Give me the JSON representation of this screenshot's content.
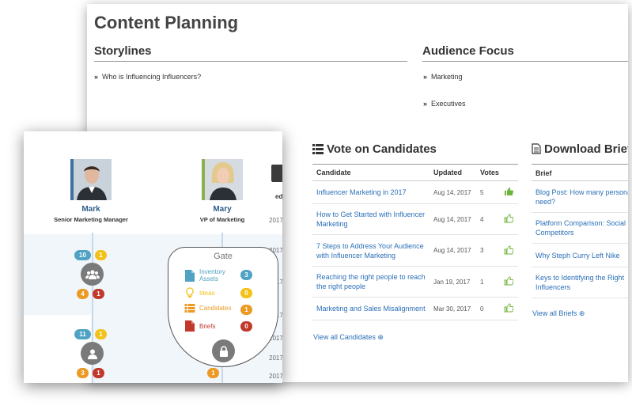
{
  "page": {
    "title": "Content Planning"
  },
  "storylines": {
    "heading": "Storylines",
    "items": [
      "Who is Influencing Influencers?"
    ]
  },
  "audience": {
    "heading": "Audience Focus",
    "items": [
      "Marketing",
      "Executives"
    ]
  },
  "bullet_glyph": "»",
  "vote": {
    "heading": "Vote on Candidates",
    "columns": {
      "candidate": "Candidate",
      "updated": "Updated",
      "votes": "Votes"
    },
    "rows": [
      {
        "candidate": "Influencer Marketing in 2017",
        "updated": "Aug 14, 2017",
        "votes": "5",
        "thumb": "filled"
      },
      {
        "candidate": "How to Get Started with Influencer Marketing",
        "updated": "Aug 14, 2017",
        "votes": "4",
        "thumb": "outline"
      },
      {
        "candidate": "7 Steps to Address Your Audience with Influencer Marketing",
        "updated": "Aug 14, 2017",
        "votes": "3",
        "thumb": "outline"
      },
      {
        "candidate": "Reaching the right people to reach the right people",
        "updated": "Jan 19, 2017",
        "votes": "1",
        "thumb": "outline"
      },
      {
        "candidate": "Marketing and Sales Misalignment",
        "updated": "Mar 30, 2017",
        "votes": "0",
        "thumb": "outline"
      }
    ],
    "view_all": "View all Candidates ⊕"
  },
  "briefs": {
    "heading": "Download Brief",
    "column": "Brief",
    "rows": [
      "Blog Post: How many personal need?",
      "Platform Comparison: Social Competitors",
      "Why Steph Curry Left Nike",
      "Keys to Identifying the Right Influencers"
    ],
    "view_all": "View all Briefs ⊕"
  },
  "team": {
    "people": [
      {
        "name": "Mark",
        "role": "Senior Marketing Manager"
      },
      {
        "name": "Mary",
        "role": "VP of Marketing"
      }
    ],
    "submit_label": "mit",
    "ghost_header": "ed",
    "ghost_years": [
      "2017",
      "2017",
      "2017",
      "2017",
      "2017",
      "2017",
      "2017"
    ]
  },
  "workflow": {
    "group_top": {
      "blue": "10",
      "yellow": "1",
      "orange": "4",
      "red": "1"
    },
    "group_bottom": {
      "blue": "11",
      "yellow": "1",
      "orange": "3",
      "red": "1"
    },
    "gate_bottom_badge": "1"
  },
  "gate": {
    "title": "Gate",
    "items": [
      {
        "label": "Inventory Assets",
        "count": "3",
        "color": "#4fa2c4",
        "icon": "document-icon"
      },
      {
        "label": "Ideas",
        "count": "0",
        "color": "#f2c21b",
        "icon": "lightbulb-icon"
      },
      {
        "label": "Candidates",
        "count": "1",
        "color": "#eb9a24",
        "icon": "list-icon"
      },
      {
        "label": "Briefs",
        "count": "0",
        "color": "#c0392b",
        "icon": "pdf-icon"
      }
    ]
  },
  "colors": {
    "link": "#2a6fb7",
    "thumb_green": "#6fb33b",
    "heading": "#333333"
  }
}
